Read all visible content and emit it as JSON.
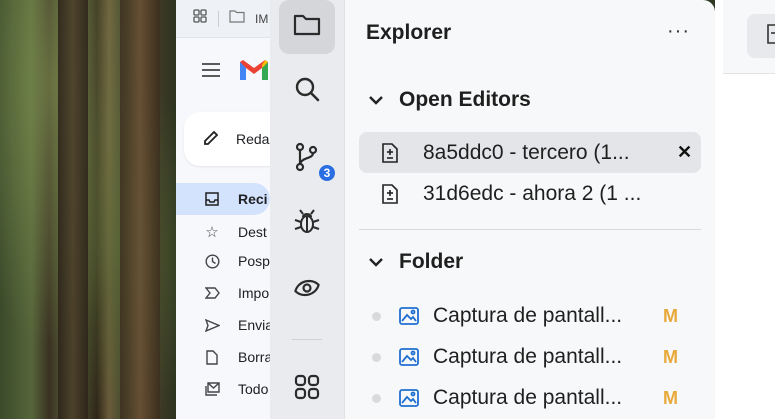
{
  "browser": {
    "topbar_label": "IM",
    "compose_label": "Reda",
    "nav": [
      {
        "label": "Reci",
        "icon": "inbox-icon",
        "active": true
      },
      {
        "label": "Dest",
        "icon": "star-icon"
      },
      {
        "label": "Posp",
        "icon": "clock-icon"
      },
      {
        "label": "Impo",
        "icon": "important-icon"
      },
      {
        "label": "Envia",
        "icon": "send-icon"
      },
      {
        "label": "Borra",
        "icon": "draft-icon"
      },
      {
        "label": "Todo",
        "icon": "all-mail-icon"
      }
    ]
  },
  "activity_bar": {
    "items": [
      {
        "name": "explorer",
        "icon": "folder-icon",
        "active": true
      },
      {
        "name": "search",
        "icon": "search-icon"
      },
      {
        "name": "source-control",
        "icon": "source-control-icon",
        "badge": "3"
      },
      {
        "name": "run-debug",
        "icon": "bug-icon"
      },
      {
        "name": "timeline",
        "icon": "eye-icon"
      },
      {
        "name": "extensions",
        "icon": "grid-icon"
      }
    ]
  },
  "explorer": {
    "title": "Explorer",
    "more_label": "···",
    "open_editors": {
      "heading": "Open Editors",
      "items": [
        {
          "label": "8a5ddc0 - tercero (1...",
          "selected": true,
          "closable": true,
          "close_label": "✕"
        },
        {
          "label": "31d6edc - ahora 2 (1 ...",
          "selected": false
        }
      ]
    },
    "folder": {
      "heading": "Folder",
      "items": [
        {
          "label": "Captura de pantall...",
          "status": "M"
        },
        {
          "label": "Captura de pantall...",
          "status": "M"
        },
        {
          "label": "Captura de pantall...",
          "status": "M"
        }
      ]
    }
  },
  "colors": {
    "modified": "#e8a93a",
    "badge": "#2b6de2",
    "image_icon": "#1f6fd1"
  }
}
